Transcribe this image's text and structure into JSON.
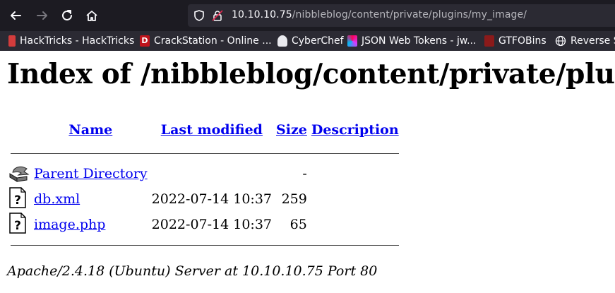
{
  "browser": {
    "url_host": "10.10.10.75",
    "url_path": "/nibbleblog/content/private/plugins/my_image/",
    "bookmarks": [
      {
        "label": "HackTricks - HackTricks",
        "icon": "hacktricks-icon"
      },
      {
        "label": "CrackStation - Online ...",
        "icon": "crackstation-icon"
      },
      {
        "label": "CyberChef",
        "icon": "cyberchef-icon"
      },
      {
        "label": "JSON Web Tokens - jw...",
        "icon": "jwt-icon"
      },
      {
        "label": "GTFOBins",
        "icon": "gtfobins-icon"
      },
      {
        "label": "Reverse S",
        "icon": "globe-icon"
      }
    ]
  },
  "page": {
    "title": "Index of /nibbleblog/content/private/plugins/my_image/",
    "columns": {
      "name": "Name",
      "last_modified": "Last modified",
      "size": "Size",
      "description": "Description"
    },
    "parent": {
      "name": "Parent Directory",
      "modified": "",
      "size": "-",
      "icon": "back-arrow-icon"
    },
    "files": [
      {
        "name": "db.xml",
        "modified": "2022-07-14 10:37",
        "size": "259",
        "icon": "unknown-file-icon"
      },
      {
        "name": "image.php",
        "modified": "2022-07-14 10:37",
        "size": "65",
        "icon": "unknown-file-icon"
      }
    ],
    "footer": "Apache/2.4.18 (Ubuntu) Server at 10.10.10.75 Port 80"
  },
  "colors": {
    "toolbar_bg": "#1c1b22",
    "urlbar_bg": "#2b2a33",
    "link": "#0000ee"
  }
}
